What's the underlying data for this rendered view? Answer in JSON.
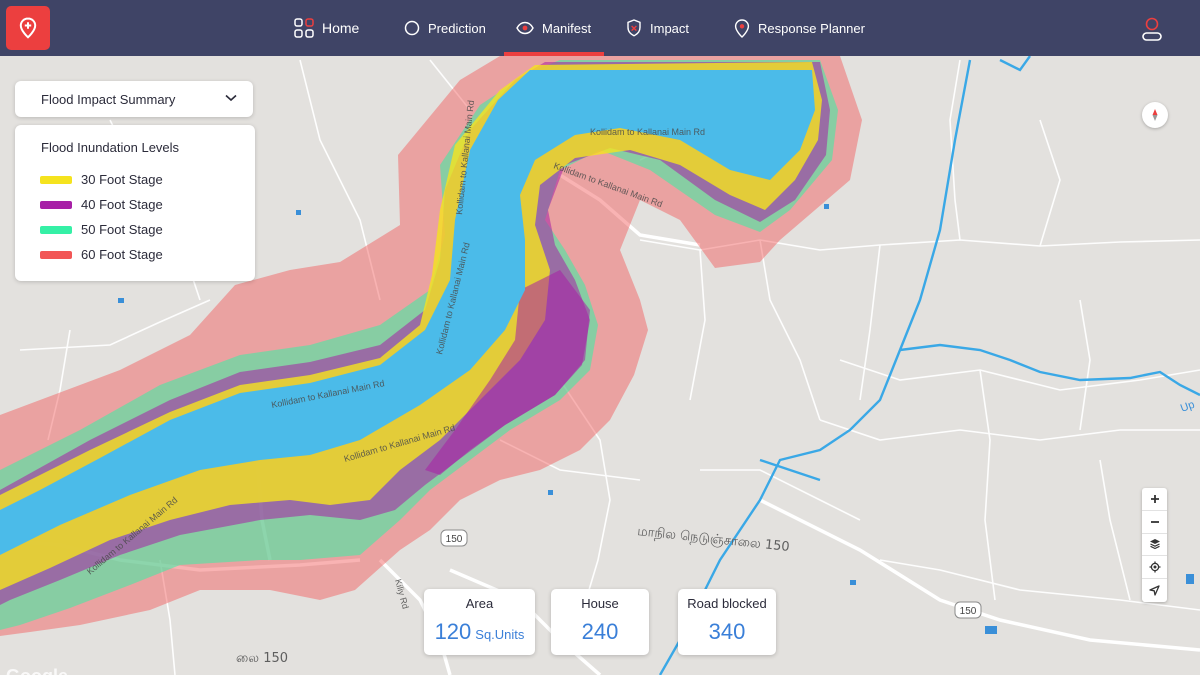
{
  "nav": {
    "items": [
      {
        "label": "Home",
        "icon": "grid-icon"
      },
      {
        "label": "Prediction",
        "icon": "circle-icon"
      },
      {
        "label": "Manifest",
        "icon": "eye-icon",
        "active": true
      },
      {
        "label": "Impact",
        "icon": "shield-icon"
      },
      {
        "label": "Response Planner",
        "icon": "map-pin-icon"
      }
    ],
    "logo_icon": "location-plus-icon",
    "user_icon": "user-icon"
  },
  "summary_dropdown": {
    "label": "Flood Impact Summary"
  },
  "legend": {
    "title": "Flood Inundation Levels",
    "items": [
      {
        "label": "30 Foot Stage",
        "color": "#f5e31e"
      },
      {
        "label": "40 Foot Stage",
        "color": "#a71fa6"
      },
      {
        "label": "50 Foot Stage",
        "color": "#35f0a6"
      },
      {
        "label": "60 Foot Stage",
        "color": "#f25656"
      }
    ]
  },
  "stats": {
    "area": {
      "label": "Area",
      "value": "120",
      "unit": "Sq.Units"
    },
    "house": {
      "label": "House",
      "value": "240"
    },
    "road": {
      "label": "Road blocked",
      "value": "340"
    }
  },
  "map": {
    "road_labels": [
      "Kollidam to Kallanai Main Rd",
      "Kollidam to Kallanai Main Rd",
      "Kollidam to Kallanai Main Rd",
      "Kollidam to Kallanai Main Rd",
      "Kollidam to Kallanai Main Rd",
      "Kollidam to Kallanai Main Rd",
      "Kollidam to Kallanai Main Rd",
      "Kiliy Rd"
    ],
    "tamil_label": "மாநில நெடுஞ்சாலை 150",
    "tamil_label_bottom": "லை 150",
    "shields": [
      "150",
      "150"
    ],
    "edge_label": "Up",
    "attribution": "Google",
    "colors": {
      "land": "#e3e1de",
      "river": "#4bbbe9",
      "stream": "#3aa8e6",
      "road": "#ffffff"
    }
  },
  "controls": [
    "zoom-in-icon",
    "zoom-out-icon",
    "layers-icon",
    "locate-icon",
    "navigate-icon"
  ]
}
